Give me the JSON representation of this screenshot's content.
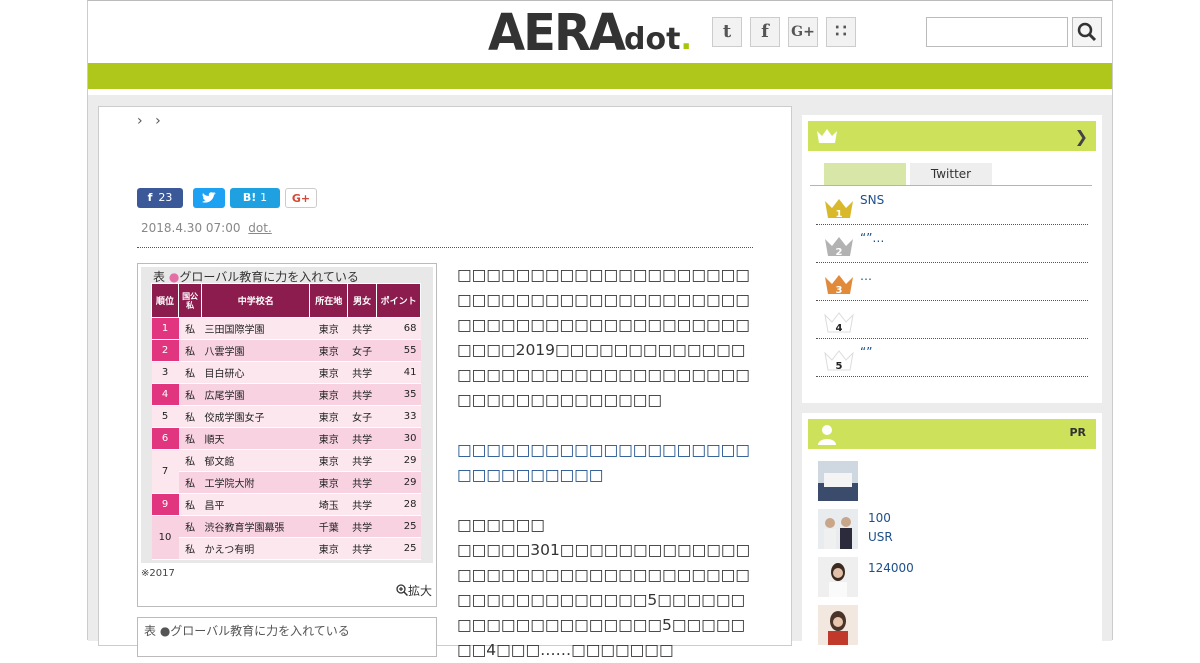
{
  "header": {
    "logo_main": "AERA",
    "logo_sub": "dot",
    "logo_dot": ".",
    "social": [
      {
        "icon": "twitter-icon",
        "glyph": "t"
      },
      {
        "icon": "facebook-icon",
        "glyph": "f"
      },
      {
        "icon": "google-plus-icon",
        "glyph": "G+"
      },
      {
        "icon": "rss-icon",
        "glyph": "∷"
      }
    ],
    "search": {
      "placeholder": ""
    },
    "accent_color": "#aec71a"
  },
  "breadcrumb": {
    "sep1": "›",
    "sep2": "›"
  },
  "share": {
    "facebook_count": "23",
    "hatena_label": "B!",
    "hatena_count": "1",
    "google_label": "G+"
  },
  "article": {
    "date": "2018.4.30 07:00",
    "source": "dot.",
    "figure": {
      "title_prefix": "表",
      "title_mark": "●",
      "title_text": "グローバル教育に力を入れている",
      "headers": [
        "順位",
        "国公私",
        "中学校名",
        "所在地",
        "男女",
        "ポイント"
      ],
      "rows": [
        {
          "rank": "1",
          "type": "私",
          "name": "三田国際学園",
          "pref": "東京",
          "gender": "共学",
          "points": "68"
        },
        {
          "rank": "2",
          "type": "私",
          "name": "八雲学園",
          "pref": "東京",
          "gender": "女子",
          "points": "55"
        },
        {
          "rank": "3",
          "type": "私",
          "name": "目白研心",
          "pref": "東京",
          "gender": "共学",
          "points": "41"
        },
        {
          "rank": "4",
          "type": "私",
          "name": "広尾学園",
          "pref": "東京",
          "gender": "共学",
          "points": "35"
        },
        {
          "rank": "5",
          "type": "私",
          "name": "佼成学園女子",
          "pref": "東京",
          "gender": "女子",
          "points": "33"
        },
        {
          "rank": "6",
          "type": "私",
          "name": "順天",
          "pref": "東京",
          "gender": "共学",
          "points": "30"
        },
        {
          "rank": "7",
          "type": "私",
          "name": "郁文館",
          "pref": "東京",
          "gender": "共学",
          "points": "29"
        },
        {
          "rank": "",
          "type": "私",
          "name": "工学院大附",
          "pref": "東京",
          "gender": "共学",
          "points": "29"
        },
        {
          "rank": "9",
          "type": "私",
          "name": "昌平",
          "pref": "埼玉",
          "gender": "共学",
          "points": "28"
        },
        {
          "rank": "10",
          "type": "私",
          "name": "渋谷教育学園幕張",
          "pref": "千葉",
          "gender": "共学",
          "points": "25"
        },
        {
          "rank": "",
          "type": "私",
          "name": "かえつ有明",
          "pref": "東京",
          "gender": "共学",
          "points": "25"
        }
      ],
      "note": "※2017",
      "zoom_label": "拡大",
      "second_title": "表 ●グローバル教育に力を入れている"
    },
    "para1": "□□□□□□□□□□□□□□□□□□□□□□□□□□□□□□□□□□□□□□□□□□□□□□□□□□□□□□□□□□□□□□□□2019□□□□□□□□□□□□□□□□□□□□□□□□□□□□□□□□□□□□□□□□□□□□□□□",
    "link_text": "□□□□□□□□□□□□□□□□□□□□□□□□□□□□□□",
    "subhead": "□□□□□□",
    "para2": "□□□□□301□□□□□□□□□□□□□□□□□□□□□□□□□□□□□□□□□□□□□□□□□□□□□□5□□□□□□□□□□□□□□□□□□□□5□□□□□□□4□□□……□□□□□□□"
  },
  "ranking": {
    "tab_active": "",
    "tab_twitter": "Twitter",
    "items": [
      {
        "num": "1",
        "label": "SNS",
        "color": "#d9b92b"
      },
      {
        "num": "2",
        "label": "“”…",
        "color": "#b2b2b2"
      },
      {
        "num": "3",
        "label": "…",
        "color": "#e08a3a"
      },
      {
        "num": "4",
        "label": "",
        "color": "#ffffff"
      },
      {
        "num": "5",
        "label": "“”",
        "color": "#ffffff"
      }
    ]
  },
  "pr": {
    "label": "PR",
    "items": [
      {
        "line1": "",
        "line2": ""
      },
      {
        "line1": "100",
        "line2": "USR"
      },
      {
        "line1": "124000",
        "line2": ""
      },
      {
        "line1": "",
        "line2": ""
      }
    ]
  }
}
